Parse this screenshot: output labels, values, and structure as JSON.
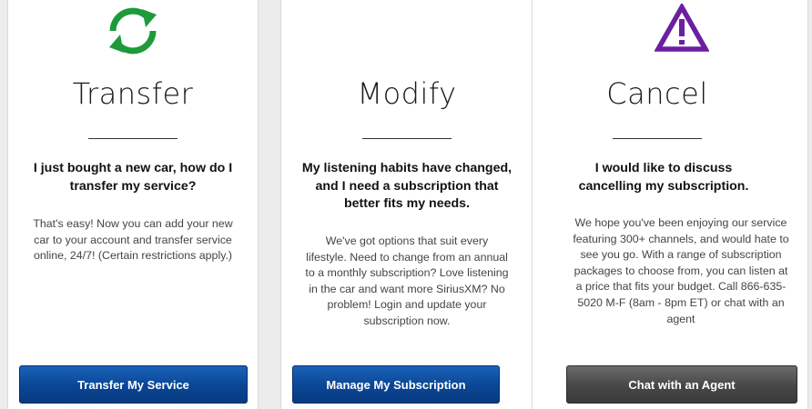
{
  "cards": [
    {
      "title": "Transfer",
      "question": "I just bought a new car, how do I transfer my service?",
      "body": "That's easy! Now you can add your new car to your account and transfer service online, 24/7! (Certain restrictions apply.)",
      "button": "Transfer My Service",
      "icon": "refresh-arrows-icon",
      "accent": "#1e9a3a"
    },
    {
      "title": "Modify",
      "question": "My listening habits have changed, and I need a subscription that better fits my needs.",
      "body": "We've got options that suit every lifestyle. Need to change from an annual to a monthly subscription? Love listening in the car and want more SiriusXM? No problem! Login and update your subscription now.",
      "button": "Manage My Subscription",
      "icon": "",
      "accent": "#0a4595"
    },
    {
      "title": "Cancel",
      "question": "I would like to discuss cancelling my subscription.",
      "body": "We hope you've been enjoying our service featuring 300+ channels, and would hate to see you go. With a range of subscription packages to choose from, you can listen at a price that fits your budget. Call 866-635-5020 M-F (8am - 8pm ET) or chat with an agent",
      "button": "Chat with an Agent",
      "icon": "warning-triangle-icon",
      "accent": "#6b1fa0"
    }
  ]
}
